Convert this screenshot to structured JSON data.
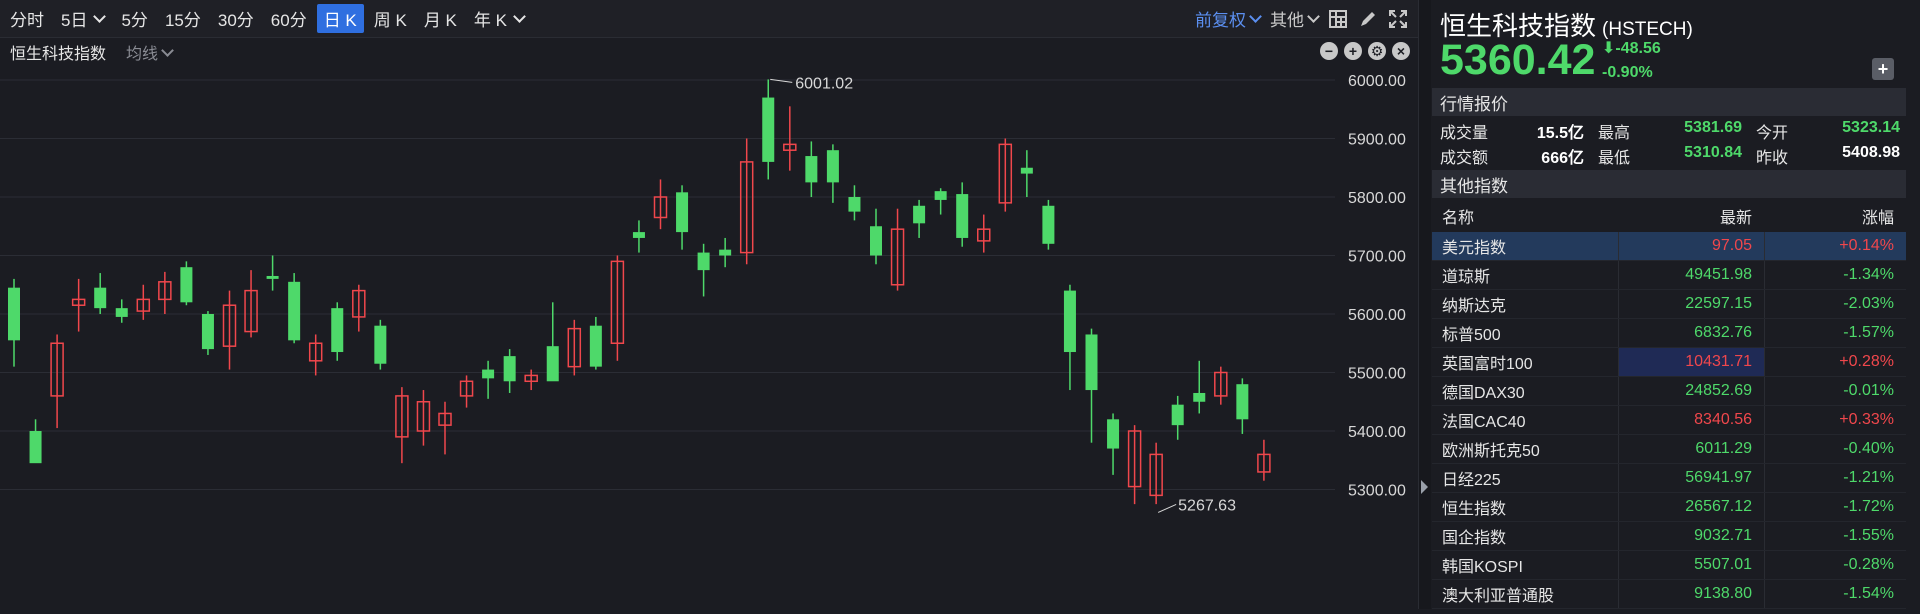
{
  "toolbar": {
    "periods": [
      {
        "label": "分时",
        "dropdown": false,
        "active": false
      },
      {
        "label": "5日",
        "dropdown": true,
        "active": false
      },
      {
        "label": "5分",
        "dropdown": false,
        "active": false
      },
      {
        "label": "15分",
        "dropdown": false,
        "active": false
      },
      {
        "label": "30分",
        "dropdown": false,
        "active": false
      },
      {
        "label": "60分",
        "dropdown": false,
        "active": false
      },
      {
        "label": "日 K",
        "dropdown": false,
        "active": true
      },
      {
        "label": "周 K",
        "dropdown": false,
        "active": false
      },
      {
        "label": "月 K",
        "dropdown": false,
        "active": false
      },
      {
        "label": "年 K",
        "dropdown": true,
        "active": false
      }
    ],
    "adjust_label": "前复权",
    "other_label": "其他"
  },
  "subbar": {
    "index_name": "恒生科技指数",
    "ma_label": "均线"
  },
  "chart_data": {
    "type": "candlestick",
    "y_ticks": [
      "6000.00",
      "5900.00",
      "5800.00",
      "5700.00",
      "5600.00",
      "5500.00",
      "5400.00",
      "5300.00"
    ],
    "ylim": [
      5280,
      6010
    ],
    "max_label": "6001.02",
    "min_label": "5267.63",
    "max_value": 6001.02,
    "min_value": 5267.63,
    "colors": {
      "up": "#f0474c",
      "down": "#4ed96a"
    },
    "candles": [
      [
        5645,
        5555,
        5660,
        5510
      ],
      [
        5400,
        5345,
        5420,
        5362
      ],
      [
        5460,
        5550,
        5565,
        5405
      ],
      [
        5615,
        5625,
        5660,
        5570
      ],
      [
        5645,
        5610,
        5670,
        5600
      ],
      [
        5610,
        5595,
        5625,
        5585
      ],
      [
        5605,
        5625,
        5650,
        5590
      ],
      [
        5625,
        5655,
        5672,
        5600
      ],
      [
        5680,
        5620,
        5690,
        5615
      ],
      [
        5600,
        5540,
        5605,
        5530
      ],
      [
        5545,
        5615,
        5640,
        5505
      ],
      [
        5570,
        5640,
        5675,
        5560
      ],
      [
        5665,
        5660,
        5700,
        5640
      ],
      [
        5655,
        5555,
        5670,
        5550
      ],
      [
        5520,
        5550,
        5565,
        5495
      ],
      [
        5610,
        5535,
        5620,
        5520
      ],
      [
        5595,
        5640,
        5650,
        5570
      ],
      [
        5580,
        5515,
        5590,
        5505
      ],
      [
        5390,
        5460,
        5475,
        5345
      ],
      [
        5400,
        5450,
        5470,
        5375
      ],
      [
        5410,
        5430,
        5450,
        5360
      ],
      [
        5460,
        5485,
        5495,
        5440
      ],
      [
        5505,
        5490,
        5520,
        5455
      ],
      [
        5528,
        5485,
        5540,
        5465
      ],
      [
        5485,
        5495,
        5505,
        5470
      ],
      [
        5545,
        5485,
        5620,
        5490
      ],
      [
        5510,
        5575,
        5590,
        5495
      ],
      [
        5580,
        5510,
        5595,
        5505
      ],
      [
        5550,
        5690,
        5700,
        5520
      ],
      [
        5740,
        5730,
        5760,
        5705
      ],
      [
        5765,
        5800,
        5830,
        5745
      ],
      [
        5808,
        5740,
        5820,
        5710
      ],
      [
        5705,
        5675,
        5720,
        5630
      ],
      [
        5710,
        5700,
        5730,
        5680
      ],
      [
        5705,
        5860,
        5900,
        5685
      ],
      [
        5970,
        5860,
        6001,
        5830
      ],
      [
        5880,
        5890,
        5955,
        5845
      ],
      [
        5870,
        5825,
        5895,
        5800
      ],
      [
        5880,
        5825,
        5890,
        5790
      ],
      [
        5800,
        5775,
        5820,
        5760
      ],
      [
        5750,
        5700,
        5780,
        5685
      ],
      [
        5650,
        5745,
        5780,
        5640
      ],
      [
        5785,
        5755,
        5795,
        5730
      ],
      [
        5810,
        5795,
        5815,
        5770
      ],
      [
        5805,
        5730,
        5825,
        5715
      ],
      [
        5725,
        5745,
        5770,
        5705
      ],
      [
        5790,
        5890,
        5900,
        5775
      ],
      [
        5850,
        5840,
        5880,
        5800
      ],
      [
        5785,
        5720,
        5795,
        5710
      ],
      [
        5640,
        5535,
        5650,
        5470
      ],
      [
        5565,
        5470,
        5575,
        5380
      ],
      [
        5420,
        5370,
        5430,
        5325
      ],
      [
        5305,
        5400,
        5410,
        5275
      ],
      [
        5290,
        5360,
        5380,
        5275
      ],
      [
        5445,
        5410,
        5460,
        5385
      ],
      [
        5465,
        5450,
        5520,
        5430
      ],
      [
        5460,
        5500,
        5510,
        5445
      ],
      [
        5480,
        5420,
        5490,
        5395
      ],
      [
        5330,
        5360,
        5385,
        5315
      ]
    ]
  },
  "panel": {
    "title": "恒生科技指数",
    "code": "(HSTECH)",
    "price": "5360.42",
    "change": "-48.56",
    "change_pct": "-0.90%",
    "quote_section": "行情报价",
    "quote": [
      [
        {
          "label": "成交量",
          "value": "15.5亿",
          "up": false
        },
        {
          "label": "最高",
          "value": "5381.69",
          "up": true
        },
        {
          "label": "今开",
          "value": "5323.14",
          "up": true
        }
      ],
      [
        {
          "label": "成交额",
          "value": "666亿",
          "up": false
        },
        {
          "label": "最低",
          "value": "5310.84",
          "up": true
        },
        {
          "label": "昨收",
          "value": "5408.98",
          "up": false
        }
      ]
    ],
    "other_section": "其他指数",
    "table_head": {
      "name": "名称",
      "latest": "最新",
      "change": "涨幅"
    },
    "rows": [
      {
        "name": "美元指数",
        "latest": "97.05",
        "change": "+0.14%",
        "dir": "red",
        "selected": true,
        "hl": false
      },
      {
        "name": "道琼斯",
        "latest": "49451.98",
        "change": "-1.34%",
        "dir": "green",
        "selected": false,
        "hl": false
      },
      {
        "name": "纳斯达克",
        "latest": "22597.15",
        "change": "-2.03%",
        "dir": "green",
        "selected": false,
        "hl": false
      },
      {
        "name": "标普500",
        "latest": "6832.76",
        "change": "-1.57%",
        "dir": "green",
        "selected": false,
        "hl": false
      },
      {
        "name": "英国富时100",
        "latest": "10431.71",
        "change": "+0.28%",
        "dir": "red",
        "selected": false,
        "hl": true
      },
      {
        "name": "德国DAX30",
        "latest": "24852.69",
        "change": "-0.01%",
        "dir": "green",
        "selected": false,
        "hl": false
      },
      {
        "name": "法国CAC40",
        "latest": "8340.56",
        "change": "+0.33%",
        "dir": "red",
        "selected": false,
        "hl": false
      },
      {
        "name": "欧洲斯托克50",
        "latest": "6011.29",
        "change": "-0.40%",
        "dir": "green",
        "selected": false,
        "hl": false
      },
      {
        "name": "日经225",
        "latest": "56941.97",
        "change": "-1.21%",
        "dir": "green",
        "selected": false,
        "hl": false
      },
      {
        "name": "恒生指数",
        "latest": "26567.12",
        "change": "-1.72%",
        "dir": "green",
        "selected": false,
        "hl": false
      },
      {
        "name": "国企指数",
        "latest": "9032.71",
        "change": "-1.55%",
        "dir": "green",
        "selected": false,
        "hl": false
      },
      {
        "name": "韩国KOSPI",
        "latest": "5507.01",
        "change": "-0.28%",
        "dir": "green",
        "selected": false,
        "hl": false
      },
      {
        "name": "澳大利亚普通股",
        "latest": "9138.80",
        "change": "-1.54%",
        "dir": "green",
        "selected": false,
        "hl": false
      }
    ]
  }
}
